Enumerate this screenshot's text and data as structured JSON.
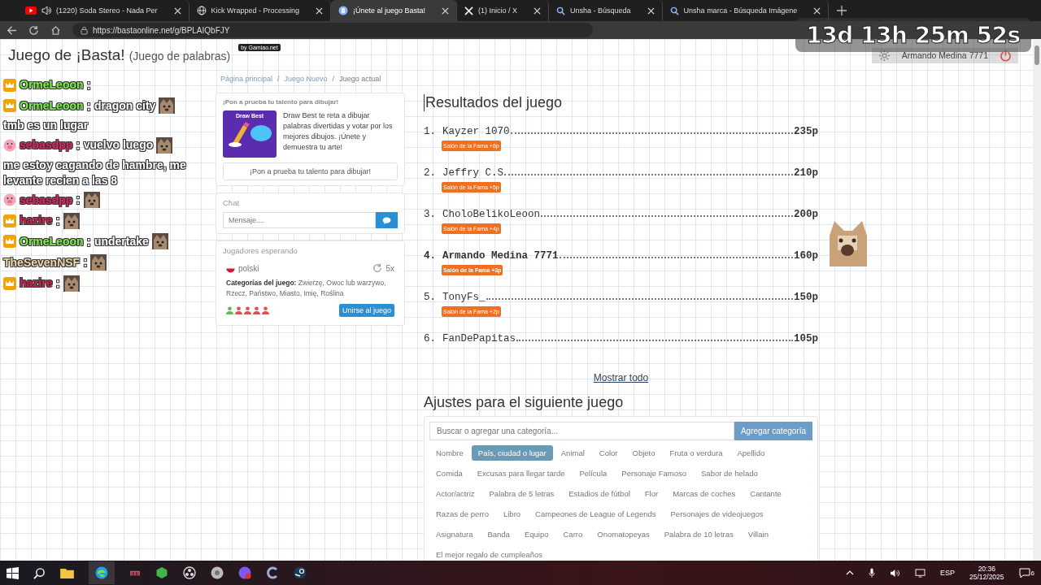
{
  "browser": {
    "tabs": [
      {
        "title": "(1220) Soda Stereo - Nada Per",
        "kind": "video",
        "audio": true,
        "selected": false
      },
      {
        "title": "Kick Wrapped - Processing",
        "kind": "globe",
        "audio": false,
        "selected": false
      },
      {
        "title": "¡Únete al juego Basta!",
        "kind": "site",
        "audio": false,
        "selected": true
      },
      {
        "title": "(1) Inicio / X",
        "kind": "x",
        "audio": false,
        "selected": false
      },
      {
        "title": "Unsha - Búsqueda",
        "kind": "search",
        "audio": false,
        "selected": false
      },
      {
        "title": "Unsha marca - Búsqueda Imágene",
        "kind": "search",
        "audio": false,
        "selected": false
      }
    ],
    "url": "https://bastaonline.net/g/BPLAIQbFJY"
  },
  "stream_overlay": {
    "timer": "13d 13h 25m 52s",
    "chat": [
      {
        "user": "OrmeLeoon",
        "separator": ":",
        "color": "#7cf04a",
        "kind": "crown"
      },
      {
        "user": "OrmeLeoon",
        "separator": ":",
        "color": "#7cf04a",
        "kind": "crown",
        "segments": [
          {
            "kind": "text",
            "text": "dragon city"
          },
          {
            "kind": "emote"
          },
          {
            "kind": "text",
            "text": "tmb es un lugar"
          }
        ]
      },
      {
        "user": "sebasdpp",
        "separator": ":",
        "color": "#e0245e",
        "kind": "pig",
        "segments": [
          {
            "kind": "text",
            "text": "vuelvo luego"
          },
          {
            "kind": "emote"
          },
          {
            "kind": "text",
            "text": "me estoy cagando de hambre, me levante recien a las 8"
          }
        ]
      },
      {
        "user": "sebasdpp",
        "separator": ":",
        "color": "#e0245e",
        "kind": "pig",
        "segments": [
          {
            "kind": "emote"
          }
        ]
      },
      {
        "user": "hazire",
        "separator": ":",
        "color": "#d4204f",
        "kind": "crown",
        "segments": [
          {
            "kind": "emote"
          }
        ]
      },
      {
        "user": "OrmeLeoon",
        "separator": ":",
        "color": "#7cf04a",
        "kind": "crown",
        "segments": [
          {
            "kind": "text",
            "text": "undertake"
          },
          {
            "kind": "emote"
          }
        ]
      },
      {
        "user": "TheSevenNSF",
        "separator": ":",
        "color": "#f0d8a8",
        "kind": "plain",
        "segments": [
          {
            "kind": "emote"
          }
        ]
      },
      {
        "user": "hazire",
        "separator": ":",
        "color": "#d4204f",
        "kind": "crown",
        "segments": [
          {
            "kind": "emote"
          }
        ]
      }
    ]
  },
  "page": {
    "title": "Juego de ¡Basta!",
    "subtitle": "(Juego de palabras)",
    "credit": "by Gamiao.net",
    "user": "Armando Medina 7771",
    "breadcrumb": [
      "Página principal",
      "Juego Nuevo",
      "Juego actual"
    ],
    "breadcrumb_separators": [
      "/",
      "/"
    ],
    "promo": {
      "heading": "¡Pon a prueba tu talento para dibujar!",
      "image_title": "Draw Best",
      "text": "Draw Best te reta a dibujar palabras divertidas y votar por los mejores dibujos. ¡Únete y demuestra tu arte!",
      "button": "¡Pon a prueba tu talento para dibujar!"
    },
    "chat": {
      "title": "Chat",
      "placeholder": "Mensaje...."
    },
    "waiting": {
      "title": "Jugadores esperando",
      "language": "polski",
      "rounds": "5x",
      "categories_label": "Categorías del juego:",
      "categories": "Zwierzę, Owoc lub warzywo, Rzecz, Państwo, Miasto, Imię, Roślina",
      "players": [
        {
          "color": "#5cb85c"
        },
        {
          "color": "#d9534f"
        },
        {
          "color": "#d9534f"
        },
        {
          "color": "#d9534f"
        },
        {
          "color": "#d9534f"
        }
      ],
      "join": "Unirse al juego"
    },
    "results": {
      "title": "Resultados del juego",
      "entries": [
        {
          "rank": "1.",
          "name": "Kayzer 1070",
          "score": "235p",
          "current": false,
          "award": "Salón de la Fama +6p"
        },
        {
          "rank": "2.",
          "name": "Jeffry C.S",
          "score": "210p",
          "current": false,
          "award": "Salón de la Fama +5p"
        },
        {
          "rank": "3.",
          "name": "CholoBelikoLeoon",
          "score": "200p",
          "current": false,
          "award": "Salón de la Fama +4p"
        },
        {
          "rank": "4.",
          "name": "Armando Medina 7771",
          "score": "160p",
          "current": true,
          "award": "Salón de la Fama +3p"
        },
        {
          "rank": "5.",
          "name": "TonyFs_",
          "score": "150p",
          "current": false,
          "award": "Salón de la Fama +2p"
        },
        {
          "rank": "6.",
          "name": "FanDePapitas",
          "score": "105p",
          "current": false
        }
      ],
      "show_all": "Mostrar todo"
    },
    "settings": {
      "title": "Ajustes para el siguiente juego",
      "placeholder": "Buscar o agregar una categoría...",
      "add_button": "Agregar categoría",
      "categories": [
        {
          "label": "Nombre",
          "selected": false
        },
        {
          "label": "País, ciudad o lugar",
          "selected": true
        },
        {
          "label": "Animal",
          "selected": false
        },
        {
          "label": "Color",
          "selected": false
        },
        {
          "label": "Objeto",
          "selected": false
        },
        {
          "label": "Fruta o verdura",
          "selected": false
        },
        {
          "label": "Apellido",
          "selected": false
        },
        {
          "label": "Comida",
          "selected": false
        },
        {
          "label": "Excusas para llegar tarde",
          "selected": false
        },
        {
          "label": "Película",
          "selected": false
        },
        {
          "label": "Personaje Famoso",
          "selected": false
        },
        {
          "label": "Sabor de helado",
          "selected": false
        },
        {
          "label": "Actor/actriz",
          "selected": false
        },
        {
          "label": "Palabra de 5 letras",
          "selected": false
        },
        {
          "label": "Estadios de fútbol",
          "selected": false
        },
        {
          "label": "Flor",
          "selected": false
        },
        {
          "label": "Marcas de coches",
          "selected": false
        },
        {
          "label": "Cantante",
          "selected": false
        },
        {
          "label": "Razas de perro",
          "selected": false
        },
        {
          "label": "Libro",
          "selected": false
        },
        {
          "label": "Campeones de League of Legends",
          "selected": false
        },
        {
          "label": "Personajes de videojuegos",
          "selected": false
        },
        {
          "label": "Asignatura",
          "selected": false
        },
        {
          "label": "Banda",
          "selected": false
        },
        {
          "label": "Equipo",
          "selected": false
        },
        {
          "label": "Carro",
          "selected": false
        },
        {
          "label": "Onomatopeyas",
          "selected": false
        },
        {
          "label": "Palabra de 10 letras",
          "selected": false
        },
        {
          "label": "Villain",
          "selected": false
        },
        {
          "label": "El mejor regalo de cumpleaños",
          "selected": false
        }
      ]
    }
  },
  "taskbar": {
    "language": "ESP",
    "time": "20:36",
    "date": "25/12/2025",
    "notifications": "6"
  }
}
